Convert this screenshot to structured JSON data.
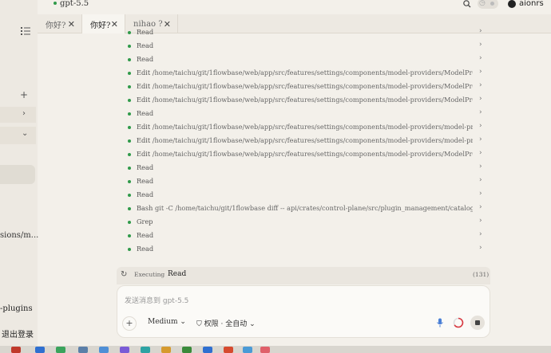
{
  "header": {
    "model": "gpt-5.5",
    "username": "aionrs"
  },
  "sidebar": {
    "truncated_item": "sions/m...",
    "plugins": "-plugins",
    "logout": "退出登录"
  },
  "tabs": [
    {
      "label": "你好?",
      "active": false
    },
    {
      "label": "你好?",
      "active": true
    },
    {
      "label": "nihao ?",
      "active": false
    }
  ],
  "tool_calls": [
    {
      "verb": "Read",
      "path": ""
    },
    {
      "verb": "Read",
      "path": ""
    },
    {
      "verb": "Read",
      "path": ""
    },
    {
      "verb": "Edit",
      "path": "/home/taichu/git/1flowbase/web/app/src/features/settings/components/model-providers/ModelProviderCatalog..."
    },
    {
      "verb": "Edit",
      "path": "/home/taichu/git/1flowbase/web/app/src/features/settings/components/model-providers/ModelProviderCatalog..."
    },
    {
      "verb": "Edit",
      "path": "/home/taichu/git/1flowbase/web/app/src/features/settings/components/model-providers/ModelProviderCatalog..."
    },
    {
      "verb": "Read",
      "path": ""
    },
    {
      "verb": "Edit",
      "path": "/home/taichu/git/1flowbase/web/app/src/features/settings/components/model-providers/model-provider-panel...."
    },
    {
      "verb": "Edit",
      "path": "/home/taichu/git/1flowbase/web/app/src/features/settings/components/model-providers/model-provider-panel...."
    },
    {
      "verb": "Edit",
      "path": "/home/taichu/git/1flowbase/web/app/src/features/settings/components/model-providers/ModelProviderCatalog..."
    },
    {
      "verb": "Read",
      "path": ""
    },
    {
      "verb": "Read",
      "path": ""
    },
    {
      "verb": "Read",
      "path": ""
    },
    {
      "verb": "Bash",
      "path": "git -C /home/taichu/git/1flowbase diff -- api/crates/control-plane/src/plugin_management/catalog.rs api/crates/..."
    },
    {
      "verb": "Grep",
      "path": ""
    },
    {
      "verb": "Read",
      "path": ""
    },
    {
      "verb": "Read",
      "path": ""
    }
  ],
  "executing": {
    "status": "Executing",
    "tool": "Read",
    "count": "(131)"
  },
  "composer": {
    "placeholder": "发送消息到 gpt-5.5",
    "effort": "Medium",
    "permission": "权限 · 全自动"
  },
  "colors": {
    "status_dot": "#2f9a4a",
    "background": "#f3f0ea",
    "ring": "#d9363e"
  },
  "icons": [
    "list-icon",
    "plus-icon",
    "chevron-right-icon",
    "chevron-down-icon",
    "search-icon",
    "clock-icon",
    "avatar-icon",
    "close-icon",
    "spinner-icon",
    "shield-icon",
    "mic-icon",
    "stop-icon"
  ]
}
